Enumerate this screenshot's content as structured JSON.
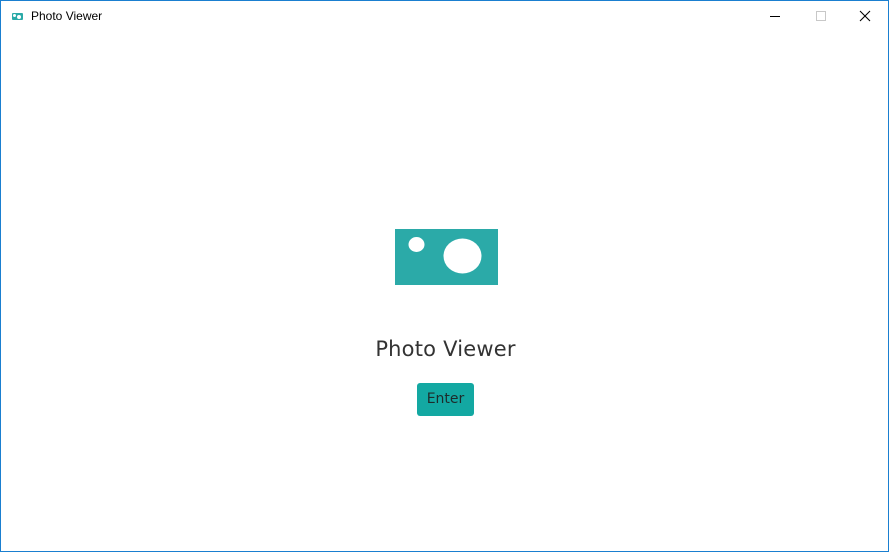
{
  "window": {
    "title": "Photo Viewer",
    "app_icon": "camera-icon",
    "controls": {
      "minimize_icon": "minimize-icon",
      "maximize_icon": "maximize-icon",
      "close_icon": "close-icon"
    }
  },
  "main": {
    "logo_icon": "camera-logo-icon",
    "heading": "Photo Viewer",
    "enter_label": "Enter"
  },
  "colors": {
    "accent": "#2baaa8",
    "button": "#13a8a2",
    "window_border": "#1a7fd0",
    "heading_text": "#333333"
  }
}
